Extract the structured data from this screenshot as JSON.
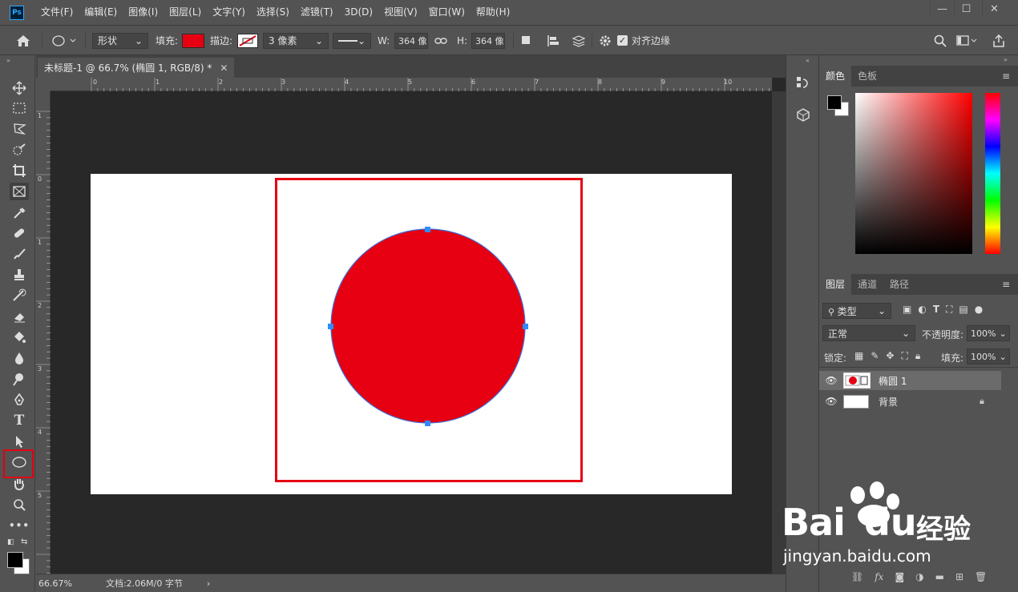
{
  "app": {
    "logo": "Ps"
  },
  "menu": [
    "文件(F)",
    "编辑(E)",
    "图像(I)",
    "图层(L)",
    "文字(Y)",
    "选择(S)",
    "滤镜(T)",
    "3D(D)",
    "视图(V)",
    "窗口(W)",
    "帮助(H)"
  ],
  "window_controls": {
    "minimize": "—",
    "maximize": "☐",
    "close": "✕"
  },
  "options": {
    "mode": "形状",
    "fill_label": "填充:",
    "fill_color": "#e60012",
    "stroke_label": "描边:",
    "stroke_width": "3 像素",
    "w_label": "W:",
    "w_value": "364 像",
    "h_label": "H:",
    "h_value": "364 像",
    "align_edges_label": "对齐边缘"
  },
  "document": {
    "tab_title": "未标题-1 @ 66.7% (椭圆 1, RGB/8) *",
    "zoom": "66.67%",
    "doc_info": "文档:2.06M/0 字节",
    "ellipse_color": "#e60012",
    "highlight_color": "#e60012",
    "hruler_labels": [
      "0",
      "1",
      "2",
      "3",
      "4",
      "5",
      "6",
      "7",
      "8",
      "9",
      "10"
    ],
    "vruler_labels": [
      "1",
      "0",
      "1",
      "2",
      "3",
      "4",
      "5"
    ]
  },
  "color_panel": {
    "tabs": [
      "颜色",
      "色板"
    ],
    "foreground": "#000000",
    "background": "#ffffff",
    "hue_color": "#ff0000"
  },
  "layers_panel": {
    "tabs": [
      "图层",
      "通道",
      "路径"
    ],
    "filter_kind": "类型",
    "blend_mode": "正常",
    "opacity_label": "不透明度:",
    "opacity_value": "100%",
    "lock_label": "锁定:",
    "fill_label": "填充:",
    "fill_value": "100%",
    "layers": [
      {
        "name": "椭圆 1"
      },
      {
        "name": "背景"
      }
    ]
  },
  "watermark": {
    "brand": "Bai",
    "brand2": "du",
    "brand3": "经验",
    "url": "jingyan.baidu.com"
  }
}
